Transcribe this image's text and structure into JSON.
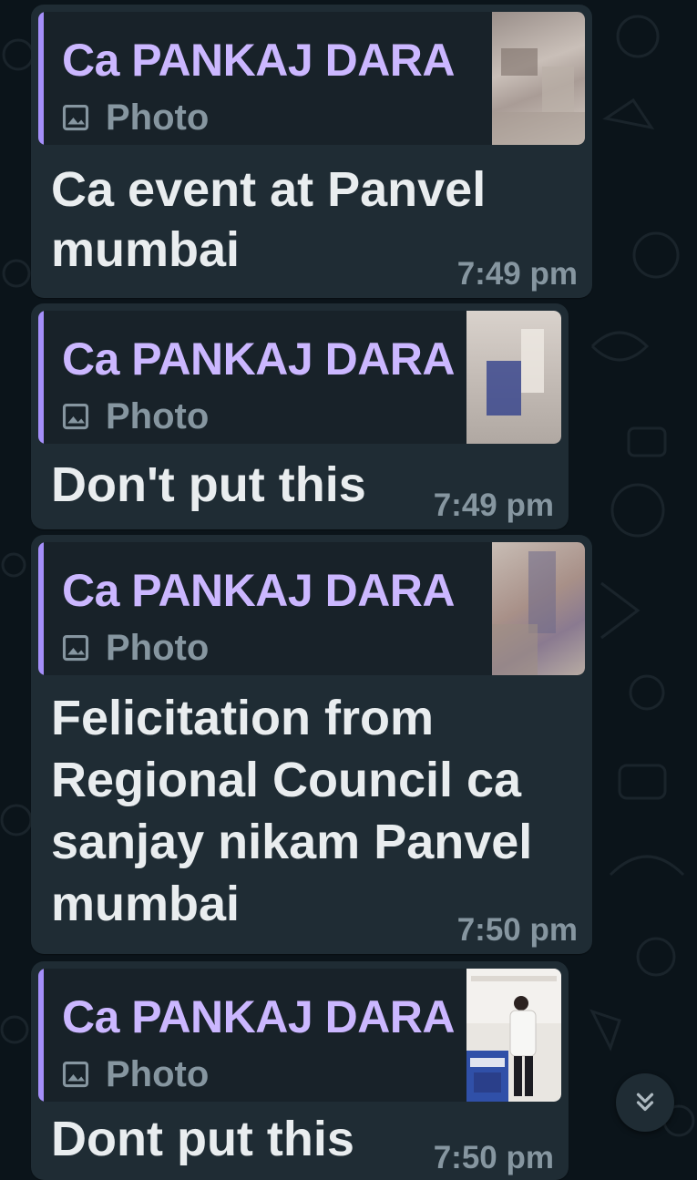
{
  "messages": [
    {
      "quote_name": "Ca PANKAJ DARA",
      "quote_type": "Photo",
      "text_lines": [
        "Ca event at Panvel",
        "mumbai"
      ],
      "time": "7:49 pm"
    },
    {
      "quote_name": "Ca PANKAJ DARA",
      "quote_type": "Photo",
      "text_lines": [
        "Don't put this"
      ],
      "time": "7:49 pm"
    },
    {
      "quote_name": "Ca PANKAJ DARA",
      "quote_type": "Photo",
      "text_lines": [
        "Felicitation from",
        "Regional Council ca",
        "sanjay nikam Panvel",
        "mumbai"
      ],
      "time": "7:50 pm"
    },
    {
      "quote_name": "Ca PANKAJ DARA",
      "quote_type": "Photo",
      "text_lines": [
        "Dont put this"
      ],
      "time": "7:50 pm"
    }
  ],
  "icons": {
    "photo": "photo-icon",
    "thumbnail": "photo-thumbnail",
    "scroll": "double-chevron-down-icon"
  },
  "colors": {
    "background": "#0b141a",
    "bubble": "#1f2c34",
    "quote_bg": "#182229",
    "quote_accent": "#a58ffa",
    "quote_name": "#cbb7ff",
    "text": "#e9edef",
    "meta": "#8696a0"
  }
}
